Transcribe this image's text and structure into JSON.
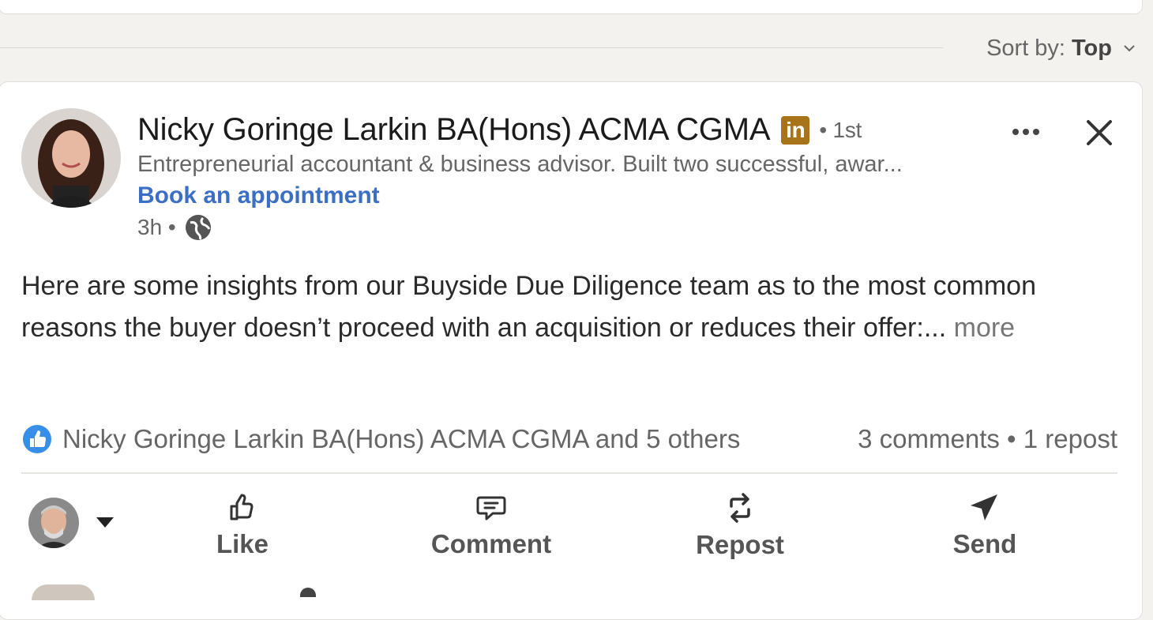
{
  "sort": {
    "label": "Sort by:",
    "value": "Top"
  },
  "post": {
    "author_name": "Nicky Goringe Larkin BA(Hons) ACMA CGMA",
    "degree": "• 1st",
    "headline": "Entrepreneurial accountant & business advisor.  Built two successful, awar...",
    "book_link": "Book an appointment",
    "time": "3h •",
    "text": "Here are some insights from our Buyside Due Diligence team as to the most common reasons the buyer doesn’t proceed with an acquisition or reduces their offer:...",
    "more_label": " more",
    "reactions": "Nicky Goringe Larkin BA(Hons) ACMA CGMA and 5 others",
    "comments_reposts": "3 comments • 1 repost"
  },
  "actions": {
    "like": "Like",
    "comment": "Comment",
    "repost": "Repost",
    "send": "Send"
  },
  "colors": {
    "link": "#3b6fc4",
    "badge": "#a8741a",
    "bg": "#f4f2ee"
  },
  "icons": [
    "linkedin-icon",
    "globe-icon",
    "more-icon",
    "close-icon",
    "like-reaction-icon",
    "like-icon",
    "comment-icon",
    "repost-icon",
    "send-icon",
    "chevron-down-icon",
    "caret-down-icon"
  ]
}
